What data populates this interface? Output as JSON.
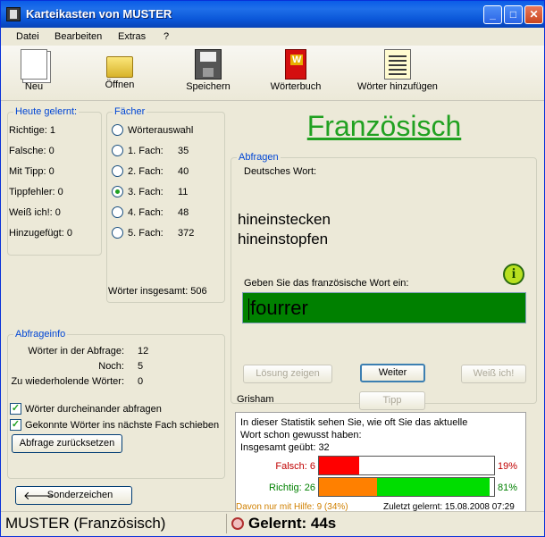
{
  "window": {
    "title": "Karteikasten von MUSTER",
    "buttons": {
      "minimize": "_",
      "maximize": "□",
      "close": "✕"
    }
  },
  "menu": [
    "Datei",
    "Bearbeiten",
    "Extras",
    "?"
  ],
  "toolbar": [
    {
      "label": "Neu",
      "icon": "new-document-icon"
    },
    {
      "label": "Öffnen",
      "icon": "folder-open-icon"
    },
    {
      "label": "Speichern",
      "icon": "floppy-disk-icon"
    },
    {
      "label": "Wörterbuch",
      "icon": "dictionary-icon"
    },
    {
      "label": "Wörter hinzufügen",
      "icon": "add-words-icon"
    }
  ],
  "today": {
    "legend": "Heute gelernt:",
    "rows": [
      "Richtige: 1",
      "Falsche: 0",
      "Mit Tipp: 0",
      "Tippfehler: 0",
      "Weiß ich!: 0",
      "Hinzugefügt: 0"
    ]
  },
  "faecher": {
    "legend": "Fächer",
    "options": [
      {
        "label": "Wörterauswahl",
        "count": "",
        "selected": false
      },
      {
        "label": "1. Fach:",
        "count": "35",
        "selected": false
      },
      {
        "label": "2. Fach:",
        "count": "40",
        "selected": false
      },
      {
        "label": "3. Fach:",
        "count": "11",
        "selected": true
      },
      {
        "label": "4. Fach:",
        "count": "48",
        "selected": false
      },
      {
        "label": "5. Fach:",
        "count": "372",
        "selected": false
      }
    ],
    "total": "Wörter insgesamt: 506"
  },
  "abfrageinfo": {
    "legend": "Abfrageinfo",
    "rows": [
      {
        "label": "Wörter in der Abfrage:",
        "value": "12"
      },
      {
        "label": "Noch:",
        "value": "5"
      },
      {
        "label": "Zu wiederholende Wörter:",
        "value": "0"
      }
    ],
    "check_shuffle": "Wörter durcheinander abfragen",
    "check_next": "Gekonnte Wörter ins nächste Fach schieben",
    "reset_button": "Abfrage zurücksetzen"
  },
  "special_chars_button": "Sonderzeichen",
  "language_title": "Französisch",
  "abfragen": {
    "legend": "Abfragen",
    "german_label": "Deutsches Wort:",
    "german_words": [
      "hineinstecken",
      "hineinstopfen"
    ],
    "prompt": "Geben Sie das französische Wort ein:",
    "answer_value": "fourrer",
    "buttons": {
      "solution": "Lösung zeigen",
      "next": "Weiter",
      "know": "Weiß ich!",
      "tip": "Tipp"
    },
    "source": "Grisham"
  },
  "stats": {
    "line1": "In dieser Statistik sehen Sie, wie oft Sie das aktuelle",
    "line2": "Wort schon gewusst haben:",
    "line3": "Insgesamt geübt: 32",
    "wrong_label": "Falsch: 6",
    "wrong_pct": "19%",
    "wrong_fraction": 0.19,
    "right_label": "Richtig: 26",
    "right_pct": "81%",
    "right_fraction": 0.81,
    "help_fraction": 0.34,
    "help_text": "Davon nur mit Hilfe: 9 (34%)",
    "last_learned": "Zuletzt gelernt: 15.08.2008 07:29",
    "colors": {
      "wrong": "#ff0000",
      "right": "#00dd00",
      "help": "#ff8000",
      "help_text": "#d08000"
    }
  },
  "status": {
    "left": "MUSTER (Französisch)",
    "right": "Gelernt: 44s"
  }
}
